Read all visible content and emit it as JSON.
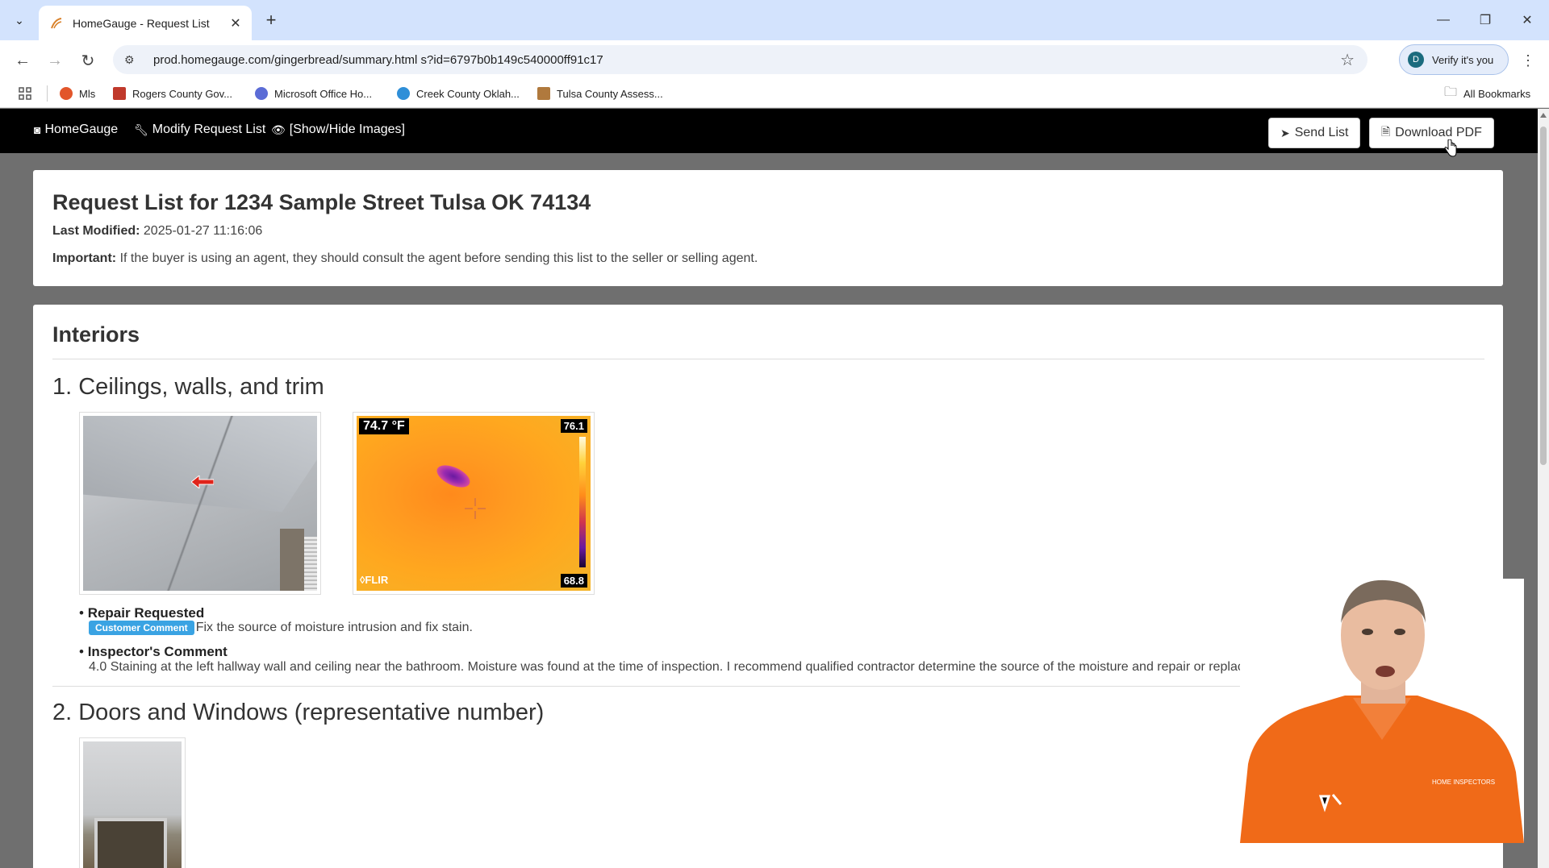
{
  "browser": {
    "tab_title": "HomeGauge - Request List",
    "tab_close": "✕",
    "new_tab": "+",
    "url": "prod.homegauge.com/gingerbread/summary.html s?id=6797b0b149c540000ff91c17",
    "profile_button": "Verify it's you",
    "profile_initial": "D",
    "all_bookmarks": "All Bookmarks",
    "bookmarks": [
      {
        "label": "Mls",
        "color": "#e2562b"
      },
      {
        "label": "Rogers County Gov...",
        "color": "#c0392b"
      },
      {
        "label": "Microsoft Office Ho...",
        "color": "#5b6cd6"
      },
      {
        "label": "Creek County Oklah...",
        "color": "#2f8fd8"
      },
      {
        "label": "Tulsa County Assess...",
        "color": "#b0793d"
      }
    ]
  },
  "appnav": {
    "home": "HomeGauge",
    "modify": "Modify Request List",
    "toggle_images": "[Show/Hide Images]",
    "send_list": "Send List",
    "download_pdf": "Download PDF"
  },
  "summary": {
    "title": "Request List for 1234 Sample Street Tulsa OK 74134",
    "last_modified_label": "Last Modified:",
    "last_modified_value": "2025-01-27 11:16:06",
    "important_label": "Important:",
    "important_text": "If the buyer is using an agent, they should consult the agent before sending this list to the seller or selling agent."
  },
  "section": {
    "title": "Interiors",
    "items": [
      {
        "heading": "1. Ceilings, walls, and trim",
        "ir_temp": "74.7 °F",
        "ir_high": "76.1",
        "ir_low": "68.8",
        "ir_brand": "◊FLIR",
        "repair_label": "Repair Requested",
        "customer_badge": "Customer Comment",
        "customer_comment": "Fix the source of moisture intrusion and fix stain.",
        "inspector_label": "Inspector's Comment",
        "inspector_comment": "4.0 Staining at the left hallway wall and ceiling near the bathroom.  Moisture was found at the time of inspection.  I recommend qualified contractor determine the source of the moisture and repair or replace as"
      },
      {
        "heading": "2. Doors and Windows (representative number)"
      }
    ]
  }
}
